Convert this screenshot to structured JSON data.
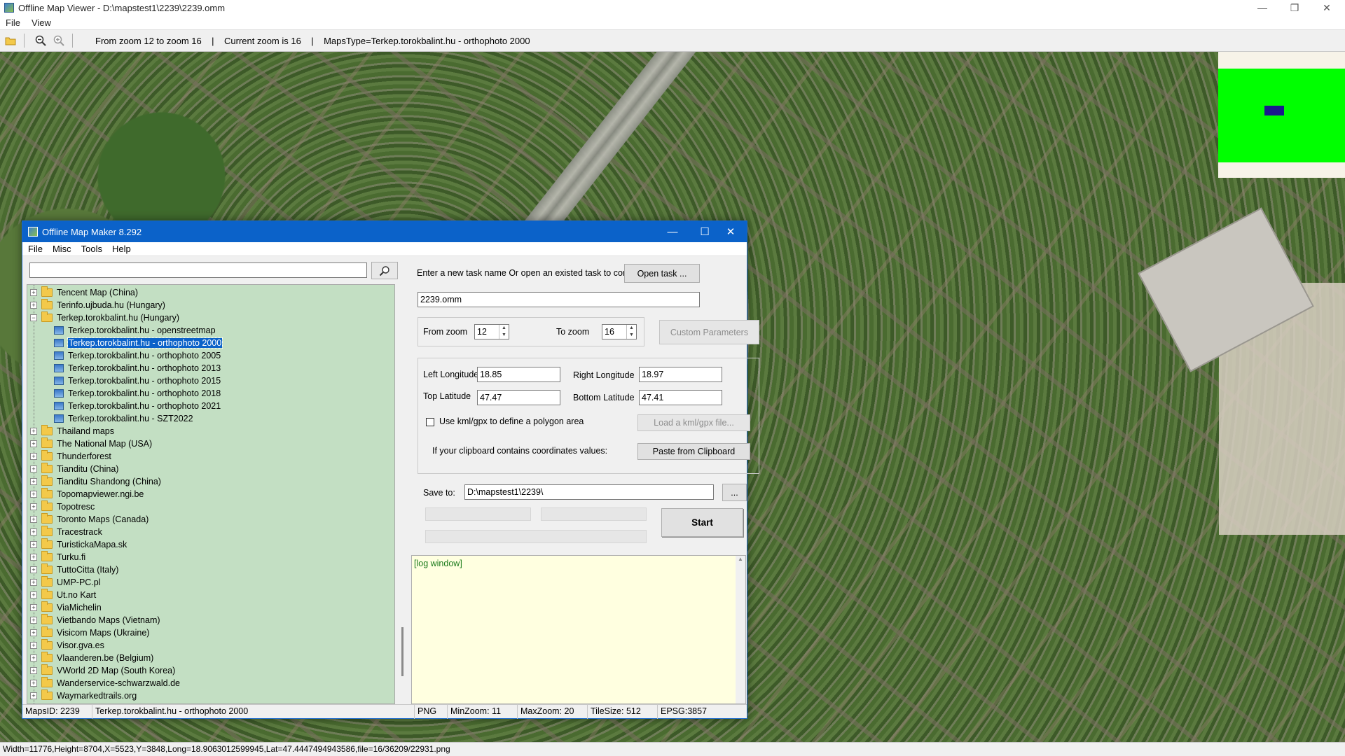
{
  "viewer": {
    "title": "Offline Map Viewer - D:\\mapstest1\\2239\\2239.omm",
    "menu": [
      "File",
      "View"
    ],
    "toolbar_info": "From zoom 12 to zoom 16    |    Current zoom is 16    |    MapsType=Terkep.torokbalint.hu - orthophoto 2000",
    "status": "Width=11776,Height=8704,X=5523,Y=3848,Long=18.9063012599945,Lat=47.4447494943586,file=16/36209/22931.png",
    "icons": {
      "open": "folder-open-icon",
      "zoom_out": "zoom-out-icon",
      "zoom_in": "zoom-in-icon",
      "minimize": "—",
      "restore": "❐",
      "close": "✕"
    }
  },
  "dialog": {
    "title": "Offline Map Maker 8.292",
    "menu": [
      "File",
      "Misc",
      "Tools",
      "Help"
    ],
    "search_placeholder": "",
    "tree": [
      {
        "label": "Tencent Map (China)",
        "expanded": false,
        "level": 0
      },
      {
        "label": "Terinfo.ujbuda.hu (Hungary)",
        "expanded": false,
        "level": 0
      },
      {
        "label": "Terkep.torokbalint.hu (Hungary)",
        "expanded": true,
        "level": 0
      },
      {
        "label": "Terkep.torokbalint.hu - openstreetmap",
        "level": 1
      },
      {
        "label": "Terkep.torokbalint.hu - orthophoto 2000",
        "level": 1,
        "selected": true
      },
      {
        "label": "Terkep.torokbalint.hu - orthophoto 2005",
        "level": 1
      },
      {
        "label": "Terkep.torokbalint.hu - orthophoto 2013",
        "level": 1
      },
      {
        "label": "Terkep.torokbalint.hu - orthophoto 2015",
        "level": 1
      },
      {
        "label": "Terkep.torokbalint.hu - orthophoto 2018",
        "level": 1
      },
      {
        "label": "Terkep.torokbalint.hu - orthophoto 2021",
        "level": 1
      },
      {
        "label": "Terkep.torokbalint.hu - SZT2022",
        "level": 1
      },
      {
        "label": "Thailand maps",
        "expanded": false,
        "level": 0
      },
      {
        "label": "The National Map (USA)",
        "expanded": false,
        "level": 0
      },
      {
        "label": "Thunderforest",
        "expanded": false,
        "level": 0
      },
      {
        "label": "Tianditu (China)",
        "expanded": false,
        "level": 0
      },
      {
        "label": "Tianditu Shandong (China)",
        "expanded": false,
        "level": 0
      },
      {
        "label": "Topomapviewer.ngi.be",
        "expanded": false,
        "level": 0
      },
      {
        "label": "Topotresc",
        "expanded": false,
        "level": 0
      },
      {
        "label": "Toronto Maps (Canada)",
        "expanded": false,
        "level": 0
      },
      {
        "label": "Tracestrack",
        "expanded": false,
        "level": 0
      },
      {
        "label": "TuristickaMapa.sk",
        "expanded": false,
        "level": 0
      },
      {
        "label": "Turku.fi",
        "expanded": false,
        "level": 0
      },
      {
        "label": "TuttoCitta (Italy)",
        "expanded": false,
        "level": 0
      },
      {
        "label": "UMP-PC.pl",
        "expanded": false,
        "level": 0
      },
      {
        "label": "Ut.no Kart",
        "expanded": false,
        "level": 0
      },
      {
        "label": "ViaMichelin",
        "expanded": false,
        "level": 0
      },
      {
        "label": "Vietbando Maps (Vietnam)",
        "expanded": false,
        "level": 0
      },
      {
        "label": "Visicom Maps (Ukraine)",
        "expanded": false,
        "level": 0
      },
      {
        "label": "Visor.gva.es",
        "expanded": false,
        "level": 0
      },
      {
        "label": "Vlaanderen.be (Belgium)",
        "expanded": false,
        "level": 0
      },
      {
        "label": "VWorld 2D Map (South Korea)",
        "expanded": false,
        "level": 0
      },
      {
        "label": "Wanderservice-schwarzwald.de",
        "expanded": false,
        "level": 0
      },
      {
        "label": "Waymarkedtrails.org",
        "expanded": false,
        "level": 0
      }
    ],
    "task_prompt": "Enter a new task name Or open an existed task to continue:",
    "open_task_label": "Open task ...",
    "task_name": "2239.omm",
    "from_zoom_label": "From zoom",
    "from_zoom": "12",
    "to_zoom_label": "To zoom",
    "to_zoom": "16",
    "custom_params_label": "Custom Parameters",
    "left_lon_label": "Left Longitude",
    "left_lon": "18.85",
    "right_lon_label": "Right Longitude",
    "right_lon": "18.97",
    "top_lat_label": "Top Latitude",
    "top_lat": "47.47",
    "bottom_lat_label": "Bottom Latitude",
    "bottom_lat": "47.41",
    "kml_label": "Use kml/gpx to define a polygon area",
    "load_kml_label": "Load a kml/gpx file...",
    "clipboard_prompt": "If your clipboard contains coordinates values:",
    "paste_label": "Paste from Clipboard",
    "save_to_label": "Save to:",
    "save_to": "D:\\mapstest1\\2239\\",
    "browse_label": "...",
    "start_label": "Start",
    "log_text": "[log window]",
    "status": {
      "maps_id": "MapsID: 2239",
      "map_name": "Terkep.torokbalint.hu - orthophoto 2000",
      "format": "PNG",
      "min_zoom": "MinZoom: 11",
      "max_zoom": "MaxZoom: 20",
      "tile_size": "TileSize: 512",
      "epsg": "EPSG:3857"
    }
  },
  "colors": {
    "dialog_titlebar": "#0b62c9",
    "tree_bg": "#c3dfc3",
    "log_bg": "#ffffe0",
    "minimap_green": "#00ff00",
    "minimap_viewport": "#1a1a8c"
  }
}
